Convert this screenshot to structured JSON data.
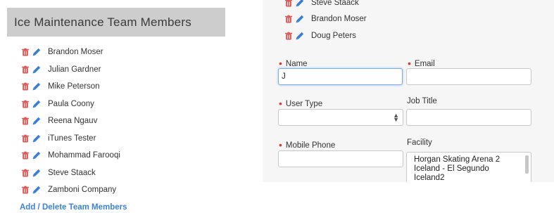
{
  "team_panel": {
    "title": "Ice Maintenance Team Members",
    "members": [
      {
        "name": "Brandon Moser"
      },
      {
        "name": "Julian Gardner"
      },
      {
        "name": "Mike Peterson"
      },
      {
        "name": "Paula Coony"
      },
      {
        "name": "Reena Ngauv"
      },
      {
        "name": "iTunes Tester"
      },
      {
        "name": "Mohammad Farooqi"
      },
      {
        "name": "Steve Staack"
      },
      {
        "name": "Zamboni Company"
      }
    ],
    "add_delete_label": "Add / Delete Team Members"
  },
  "editor": {
    "members": [
      {
        "name": "Steve Staack"
      },
      {
        "name": "Brandon Moser"
      },
      {
        "name": "Doug Peters"
      }
    ],
    "form": {
      "name_label": "Name",
      "name_value": "J",
      "email_label": "Email",
      "email_value": "",
      "user_type_label": "User Type",
      "user_type_value": "",
      "job_title_label": "Job Title",
      "job_title_value": "",
      "mobile_phone_label": "Mobile Phone",
      "mobile_phone_value": "",
      "facility_label": "Facility",
      "facility_options": [
        "Horgan Skating Arena 2",
        "Iceland - El Segundo",
        "Iceland2"
      ]
    }
  },
  "colors": {
    "delete_icon": "#d9534f",
    "edit_icon": "#3a7fd5",
    "link": "#3d84d6",
    "required": "#d33b2f",
    "panel_header_bg": "#cdcdcd"
  },
  "icons": {
    "delete": "trash-icon",
    "edit": "pencil-icon"
  }
}
